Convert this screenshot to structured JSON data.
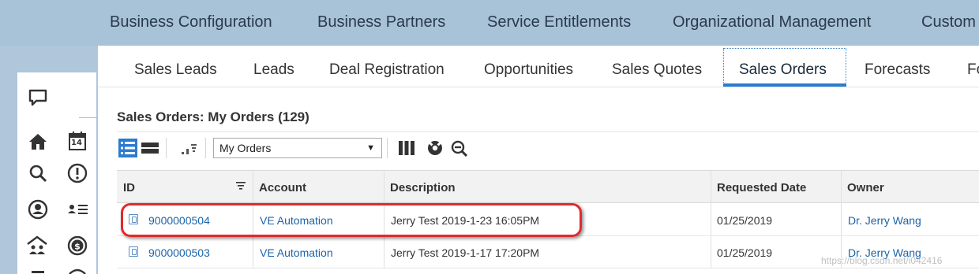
{
  "top_nav": {
    "items": [
      "Business Configuration",
      "Business Partners",
      "Service Entitlements",
      "Organizational Management",
      "Custom"
    ]
  },
  "sub_tabs": {
    "items": [
      "Sales Leads",
      "Leads",
      "Deal Registration",
      "Opportunities",
      "Sales Quotes",
      "Sales Orders",
      "Forecasts",
      "Fo"
    ],
    "active": "Sales Orders"
  },
  "left_rail": {
    "icons": [
      "feedback-icon",
      "home-icon",
      "calendar-icon",
      "search-icon",
      "alert-icon",
      "person-icon",
      "contacts-icon",
      "accounts-icon",
      "dollar-icon"
    ],
    "calendar_day": "14"
  },
  "list": {
    "title": "Sales Orders: My Orders (129)"
  },
  "toolbar": {
    "view_select_value": "My Orders"
  },
  "table": {
    "headers": {
      "id": "ID",
      "account": "Account",
      "description": "Description",
      "requested_date": "Requested Date",
      "owner": "Owner"
    },
    "rows": [
      {
        "id": "9000000504",
        "account": "VE Automation",
        "description": "Jerry Test 2019-1-23 16:05PM",
        "requested_date": "01/25/2019",
        "owner": "Dr. Jerry Wang"
      },
      {
        "id": "9000000503",
        "account": "VE Automation",
        "description": "Jerry Test 2019-1-17 17:20PM",
        "requested_date": "01/25/2019",
        "owner": "Dr. Jerry Wang"
      }
    ]
  },
  "watermark": "https://blog.csdn.net/i042416",
  "colors": {
    "accent": "#2b7bd0",
    "link": "#1c63a8",
    "highlight": "#e02a2a",
    "nav_bg": "#a8c2d8"
  }
}
